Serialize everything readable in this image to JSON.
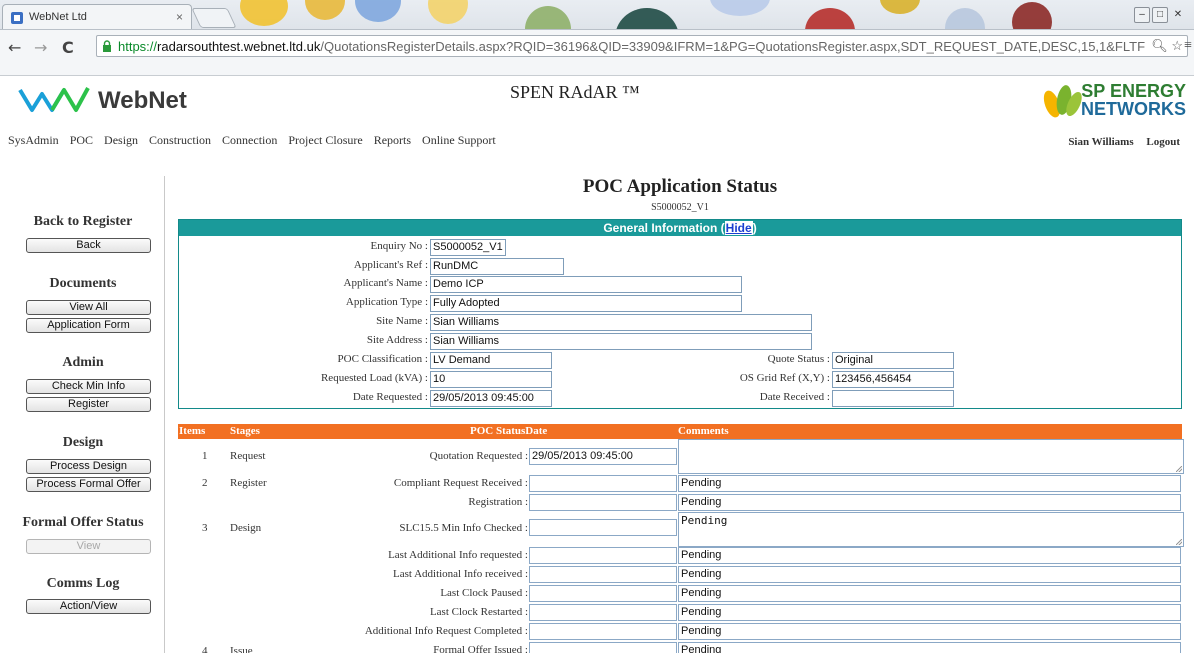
{
  "browser": {
    "tab_title": "WebNet Ltd",
    "tab_close": "×",
    "window_controls": [
      "–",
      "□",
      "✕"
    ],
    "url_scheme": "https://",
    "url_host": "radarsouthtest.webnet.ltd.uk",
    "url_path": "/QuotationsRegisterDetails.aspx?RQID=36196&QID=33909&IFRM=1&PG=QuotationsRegister.aspx,SDT_REQUEST_DATE,DESC,15,1&FLTF",
    "icons": [
      "back-arrow-icon",
      "forward-arrow-icon",
      "reload-icon",
      "lock-icon",
      "search-icon",
      "star-icon",
      "menu-icon"
    ]
  },
  "header": {
    "logo_text": "WebNet",
    "app_title": "SPEN RAdAR ™",
    "partner_logo_line1": "SP ENERGY",
    "partner_logo_line2": "NETWORKS"
  },
  "nav": {
    "items": [
      "SysAdmin",
      "POC",
      "Design",
      "Construction",
      "Connection",
      "Project Closure",
      "Reports",
      "Online Support"
    ],
    "user": "Sian Williams",
    "logout": "Logout"
  },
  "sidebar": {
    "back_title": "Back to Register",
    "back_button": "Back",
    "documents_title": "Documents",
    "view_all_button": "View All",
    "application_form_button": "Application Form",
    "admin_title": "Admin",
    "check_min_info_button": "Check Min Info",
    "register_button": "Register",
    "design_title": "Design",
    "process_design_button": "Process Design",
    "process_formal_offer_button": "Process Formal Offer",
    "formal_offer_title": "Formal Offer Status",
    "view_button": "View",
    "comms_title": "Comms Log",
    "action_view_button": "Action/View"
  },
  "page": {
    "title": "POC Application Status",
    "subtitle": "S5000052_V1"
  },
  "general_info": {
    "header": "General Information (",
    "hide_link": "Hide",
    "header_end": ")",
    "fields": {
      "enquiry_no": {
        "label": "Enquiry No :",
        "value": "S5000052_V1"
      },
      "applicants_ref": {
        "label": "Applicant's Ref :",
        "value": "RunDMC"
      },
      "applicants_name": {
        "label": "Applicant's Name :",
        "value": "Demo ICP"
      },
      "application_type": {
        "label": "Application Type :",
        "value": "Fully Adopted"
      },
      "site_name": {
        "label": "Site Name :",
        "value": "Sian Williams"
      },
      "site_address": {
        "label": "Site Address :",
        "value": "Sian Williams"
      },
      "poc_classification": {
        "label": "POC Classification :",
        "value": "LV Demand"
      },
      "requested_load": {
        "label": "Requested Load (kVA) :",
        "value": "10"
      },
      "date_requested": {
        "label": "Date Requested :",
        "value": "29/05/2013 09:45:00"
      },
      "quote_status": {
        "label": "Quote Status :",
        "value": "Original"
      },
      "os_grid_ref": {
        "label": "OS Grid Ref (X,Y) :",
        "value": "123456,456454"
      },
      "date_received": {
        "label": "Date Received :",
        "value": ""
      }
    }
  },
  "status_table": {
    "headers": {
      "items": "Items",
      "stages": "Stages",
      "poc_status_date": "POC StatusDate",
      "comments": "Comments"
    },
    "rows": [
      {
        "item": "1",
        "stage": "Request",
        "status_label": "Quotation Requested :",
        "date": "29/05/2013 09:45:00",
        "comment": ""
      },
      {
        "item": "2",
        "stage": "Register",
        "status_label": "Compliant Request Received :",
        "date": "",
        "comment": "Pending"
      },
      {
        "item": "",
        "stage": "",
        "status_label": "Registration :",
        "date": "",
        "comment": "Pending"
      },
      {
        "item": "3",
        "stage": "Design",
        "status_label": "SLC15.5 Min Info Checked :",
        "date": "",
        "comment": "Pending"
      },
      {
        "item": "",
        "stage": "",
        "status_label": "Last Additional Info requested :",
        "date": "",
        "comment": "Pending"
      },
      {
        "item": "",
        "stage": "",
        "status_label": "Last Additional Info received :",
        "date": "",
        "comment": "Pending"
      },
      {
        "item": "",
        "stage": "",
        "status_label": "Last Clock Paused :",
        "date": "",
        "comment": "Pending"
      },
      {
        "item": "",
        "stage": "",
        "status_label": "Last Clock Restarted :",
        "date": "",
        "comment": "Pending"
      },
      {
        "item": "",
        "stage": "",
        "status_label": "Additional Info Request Completed :",
        "date": "",
        "comment": "Pending"
      },
      {
        "item": "4",
        "stage": "Issue",
        "status_label": "Formal Offer Issued :",
        "date": "",
        "comment": "Pending"
      }
    ]
  }
}
